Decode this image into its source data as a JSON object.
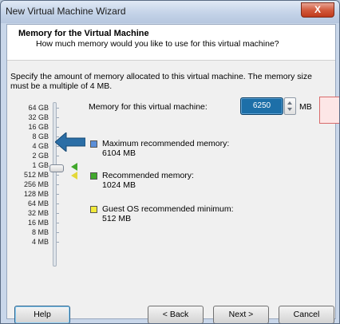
{
  "window": {
    "title": "New Virtual Machine Wizard",
    "close_glyph": "X"
  },
  "header": {
    "title": "Memory for the Virtual Machine",
    "subtitle": "How much memory would you like to use for this virtual machine?"
  },
  "description": "Specify the amount of memory allocated to this virtual machine. The memory size must be a multiple of 4 MB.",
  "scale_labels": [
    "64 GB",
    "32 GB",
    "16 GB",
    "8 GB",
    "4 GB",
    "2 GB",
    "1 GB",
    "512 MB",
    "256 MB",
    "128 MB",
    "64 MB",
    "32 MB",
    "16 MB",
    "8 MB",
    "4 MB"
  ],
  "memory": {
    "label": "Memory for this virtual machine:",
    "value": "6250",
    "unit": "MB"
  },
  "legend": {
    "max": {
      "label": "Maximum recommended memory:",
      "value": "6104 MB",
      "color": "#5b8fd9"
    },
    "rec": {
      "label": "Recommended memory:",
      "value": "1024 MB",
      "color": "#41a82c"
    },
    "guest": {
      "label": "Guest OS recommended minimum:",
      "value": "512 MB",
      "color": "#f2ea3b"
    }
  },
  "buttons": {
    "help": "Help",
    "back": "< Back",
    "next": "Next >",
    "cancel": "Cancel"
  }
}
